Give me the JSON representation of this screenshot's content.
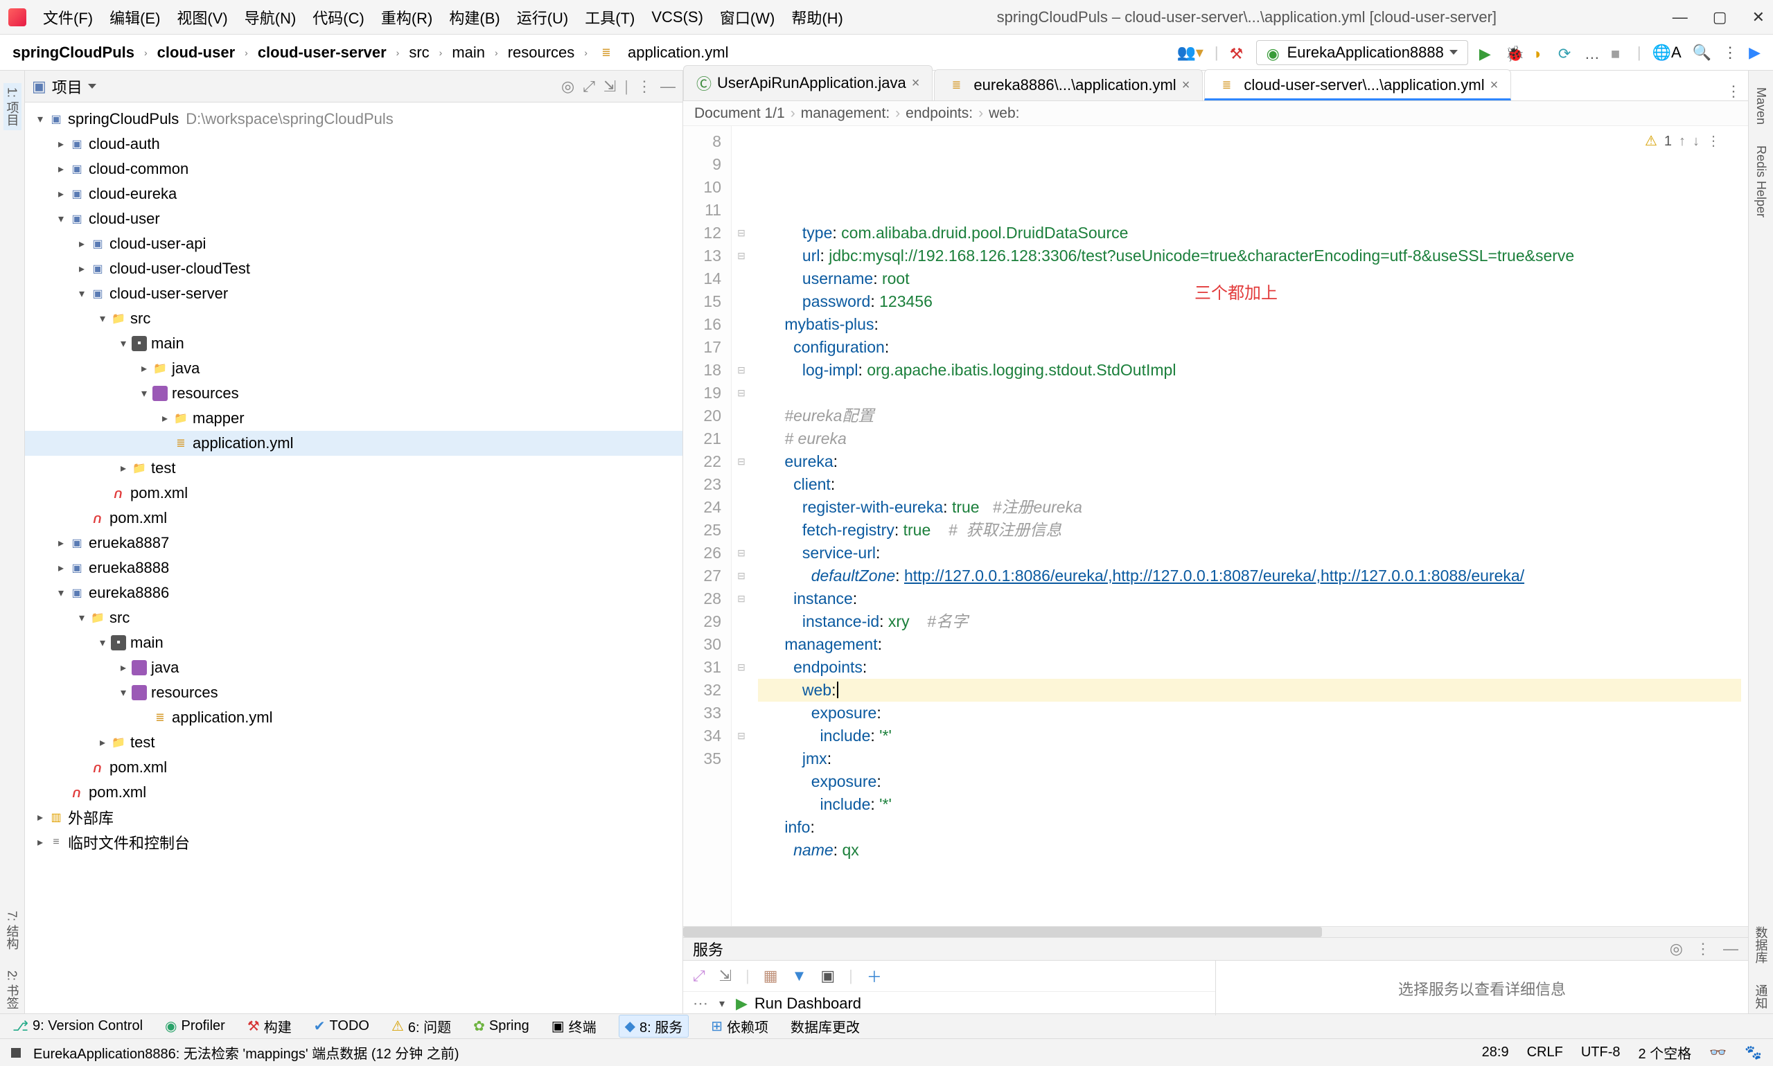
{
  "menu": {
    "items": [
      "文件(F)",
      "编辑(E)",
      "视图(V)",
      "导航(N)",
      "代码(C)",
      "重构(R)",
      "构建(B)",
      "运行(U)",
      "工具(T)",
      "VCS(S)",
      "窗口(W)",
      "帮助(H)"
    ],
    "title": "springCloudPuls – cloud-user-server\\...\\application.yml [cloud-user-server]"
  },
  "nav": {
    "crumbs": [
      "springCloudPuls",
      "cloud-user",
      "cloud-user-server",
      "src",
      "main",
      "resources",
      "application.yml"
    ],
    "run_cfg": "EurekaApplication8888"
  },
  "left_tabs": {
    "project": "1: 项目"
  },
  "right_tabs": [
    "Maven",
    "Redis Helper",
    "数据库",
    "通知"
  ],
  "proj_panel": {
    "title": "项目"
  },
  "tree": {
    "root": {
      "name": "springCloudPuls",
      "path": "D:\\workspace\\springCloudPuls"
    },
    "cloud_auth": "cloud-auth",
    "cloud_common": "cloud-common",
    "cloud_eureka": "cloud-eureka",
    "cloud_user": "cloud-user",
    "cloud_user_api": "cloud-user-api",
    "cloud_user_cloudtest": "cloud-user-cloudTest",
    "cloud_user_server": "cloud-user-server",
    "src": "src",
    "main": "main",
    "java": "java",
    "resources": "resources",
    "mapper": "mapper",
    "appyml": "application.yml",
    "test": "test",
    "pom": "pom.xml",
    "erueka87": "erueka8887",
    "erueka88": "erueka8888",
    "eureka86": "eureka8886",
    "extlib": "外部库",
    "scratch": "临时文件和控制台"
  },
  "tabs": [
    {
      "icon": "class",
      "label": "UserApiRunApplication.java"
    },
    {
      "icon": "yml",
      "label": "eureka8886\\...\\application.yml"
    },
    {
      "icon": "yml",
      "label": "cloud-user-server\\...\\application.yml",
      "active": true
    }
  ],
  "crumbbar": [
    "Document 1/1",
    "management:",
    "endpoints:",
    "web:"
  ],
  "inspection": {
    "warn_count": "1"
  },
  "annotation": "三个都加上",
  "code": {
    "start": 8,
    "lines": [
      {
        "i": "          ",
        "k": "type",
        "c": ": ",
        "v": "com.alibaba.druid.pool.DruidDataSource"
      },
      {
        "i": "          ",
        "k": "url",
        "c": ": ",
        "v": "jdbc:mysql://192.168.126.128:3306/test?useUnicode=true&characterEncoding=utf-8&useSSL=true&serve"
      },
      {
        "i": "          ",
        "k": "username",
        "c": ": ",
        "v": "root"
      },
      {
        "i": "          ",
        "k": "password",
        "c": ": ",
        "v": "123456"
      },
      {
        "i": "      ",
        "k": "mybatis-plus",
        "c": ":",
        "v": ""
      },
      {
        "i": "        ",
        "k": "configuration",
        "c": ":",
        "v": ""
      },
      {
        "i": "          ",
        "k": "log-impl",
        "c": ": ",
        "v": "org.apache.ibatis.logging.stdout.StdOutImpl"
      },
      {
        "blank": true
      },
      {
        "i": "      ",
        "cmt": "#eureka配置"
      },
      {
        "i": "      ",
        "cmt": "# eureka"
      },
      {
        "i": "      ",
        "k": "eureka",
        "c": ":",
        "v": ""
      },
      {
        "i": "        ",
        "k": "client",
        "c": ":",
        "v": ""
      },
      {
        "i": "          ",
        "k": "register-with-eureka",
        "c": ": ",
        "v": "true",
        "cm": "   #注册eureka"
      },
      {
        "i": "          ",
        "k": "fetch-registry",
        "c": ": ",
        "v": "true",
        "cm": "    #  获取注册信息"
      },
      {
        "i": "          ",
        "k": "service-url",
        "c": ":",
        "v": ""
      },
      {
        "i": "            ",
        "ki": "defaultZone",
        "c": ": ",
        "url": "http://127.0.0.1:8086/eureka/,http://127.0.0.1:8087/eureka/,http://127.0.0.1:8088/eureka/"
      },
      {
        "i": "        ",
        "k": "instance",
        "c": ":",
        "v": ""
      },
      {
        "i": "          ",
        "k": "instance-id",
        "c": ": ",
        "v": "xry",
        "cm": "    #名字"
      },
      {
        "i": "      ",
        "k": "management",
        "c": ":",
        "v": ""
      },
      {
        "i": "        ",
        "k": "endpoints",
        "c": ":",
        "v": ""
      },
      {
        "i": "          ",
        "k": "web",
        "c": ":",
        "v": "",
        "cursor": true,
        "hl": true
      },
      {
        "i": "            ",
        "k": "exposure",
        "c": ":",
        "v": ""
      },
      {
        "i": "              ",
        "k": "include",
        "c": ": ",
        "v": "'*'"
      },
      {
        "i": "          ",
        "k": "jmx",
        "c": ":",
        "v": ""
      },
      {
        "i": "            ",
        "k": "exposure",
        "c": ":",
        "v": ""
      },
      {
        "i": "              ",
        "k": "include",
        "c": ": ",
        "v": "'*'"
      },
      {
        "i": "      ",
        "k": "info",
        "c": ":",
        "v": ""
      },
      {
        "i": "        ",
        "ki": "name",
        "c": ": ",
        "v": "qx"
      }
    ]
  },
  "services": {
    "title": "服务",
    "dashboard": "Run Dashboard",
    "placeholder": "选择服务以查看详细信息"
  },
  "tool_strip": [
    "9: Version Control",
    "Profiler",
    "构建",
    "TODO",
    "6: 问题",
    "Spring",
    "终端",
    "8: 服务",
    "依赖项",
    "数据库更改"
  ],
  "tool_strip_active": "8: 服务",
  "status": {
    "left_icon": "▣",
    "msg": "EurekaApplication8886: 无法检索 'mappings' 端点数据 (12 分钟 之前)",
    "caret": "28:9",
    "eol": "CRLF",
    "enc": "UTF-8",
    "indent": "2 个空格"
  },
  "left_vert": [
    "7: 结构",
    "2: 书签"
  ]
}
